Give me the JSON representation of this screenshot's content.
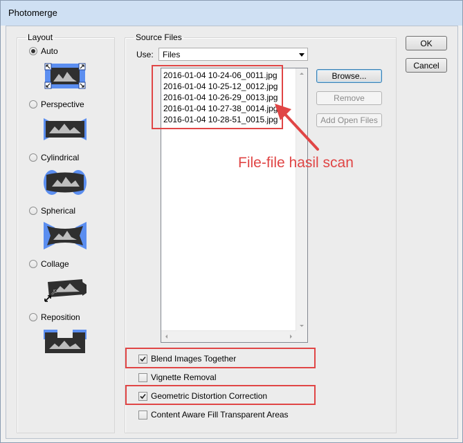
{
  "window": {
    "title": "Photomerge"
  },
  "layout": {
    "legend": "Layout",
    "options": [
      {
        "label": "Auto",
        "checked": true,
        "icon": "auto-projection-icon"
      },
      {
        "label": "Perspective",
        "checked": false,
        "icon": "perspective-projection-icon"
      },
      {
        "label": "Cylindrical",
        "checked": false,
        "icon": "cylindrical-projection-icon"
      },
      {
        "label": "Spherical",
        "checked": false,
        "icon": "spherical-projection-icon"
      },
      {
        "label": "Collage",
        "checked": false,
        "icon": "collage-projection-icon"
      },
      {
        "label": "Reposition",
        "checked": false,
        "icon": "reposition-projection-icon"
      }
    ]
  },
  "source": {
    "legend": "Source Files",
    "use_label": "Use:",
    "use_value": "Files",
    "files": [
      "2016-01-04 10-24-06_0011.jpg",
      "2016-01-04 10-25-12_0012.jpg",
      "2016-01-04 10-26-29_0013.jpg",
      "2016-01-04 10-27-38_0014.jpg",
      "2016-01-04 10-28-51_0015.jpg"
    ],
    "buttons": {
      "browse": "Browse...",
      "remove": "Remove",
      "add_open": "Add Open Files"
    }
  },
  "options": {
    "blend": {
      "label": "Blend Images Together",
      "checked": true
    },
    "vignette": {
      "label": "Vignette Removal",
      "checked": false
    },
    "geometric": {
      "label": "Geometric Distortion Correction",
      "checked": true
    },
    "content_aware": {
      "label": "Content Aware Fill Transparent Areas",
      "checked": false
    }
  },
  "actions": {
    "ok": "OK",
    "cancel": "Cancel"
  },
  "annotation": {
    "text": "File-file hasil scan",
    "color": "#e04545"
  },
  "colors": {
    "accent_blue": "#5b8ef0",
    "icon_dark": "#2f2f2f",
    "annotation_red": "#e04545"
  }
}
